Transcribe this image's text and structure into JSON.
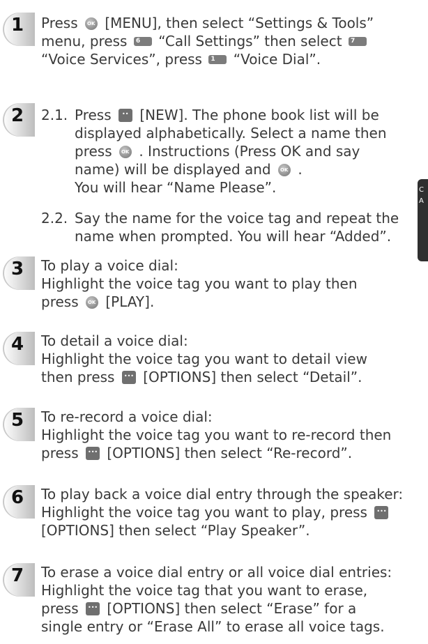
{
  "steps": [
    {
      "num": "1",
      "lines": [
        [
          "Press ",
          "ok",
          " [MENU], then select “Settings & Tools”"
        ],
        [
          "menu, press ",
          "6",
          " “Call Settings” then select ",
          "7",
          ""
        ],
        [
          "“Voice Services”, press ",
          "1",
          " “Voice Dial”."
        ]
      ]
    }
  ],
  "s1": {
    "l1a": "Press ",
    "l1b": " [MENU], then select “Settings & Tools”",
    "l2a": "menu, press ",
    "l2b": " “Call Settings” then select ",
    "l3a": "“Voice Services”, press ",
    "l3b": " “Voice Dial”."
  },
  "s2": {
    "num": "2",
    "n1": "2.1.",
    "l1a": "Press ",
    "l1b": " [NEW]. The phone book list will be",
    "l2": "displayed alphabetically. Select a name then",
    "l3a": "press ",
    "l3b": " . Instructions (Press OK and say",
    "l4a": "name) will be displayed and ",
    "l4b": " .",
    "l5": "You will hear “Name Please”.",
    "n2": "2.2.",
    "l6": "Say the name for the voice tag and repeat the",
    "l7": "name when prompted. You will hear “Added”."
  },
  "s3": {
    "num": "3",
    "l1": "To play a voice dial:",
    "l2": "Highlight the voice tag you want to play then",
    "l3a": "press ",
    "l3b": " [PLAY]."
  },
  "s4": {
    "num": "4",
    "l1": "To detail a voice dial:",
    "l2": "Highlight the voice tag you want to detail view",
    "l3a": "then press ",
    "l3b": " [OPTIONS] then select “Detail”."
  },
  "s5": {
    "num": "5",
    "l1": "To re-record a voice dial:",
    "l2": "Highlight the voice tag you want to re-record then",
    "l3a": "press ",
    "l3b": " [OPTIONS] then select “Re-record”."
  },
  "s6": {
    "num": "6",
    "l1": "To play back a voice dial entry through the speaker:",
    "l2a": "Highlight the voice tag you want to play, press ",
    "l3": "[OPTIONS] then select “Play Speaker”."
  },
  "s7": {
    "num": "7",
    "l1": "To erase a voice dial entry or all voice dial entries:",
    "l2": "Highlight the voice tag that you want to erase,",
    "l3a": "press ",
    "l3b": " [OPTIONS] then select “Erase” for a",
    "l4": "single entry or “Erase All” to erase all voice tags."
  },
  "side_tab": {
    "text": "C\nA"
  },
  "icons": [
    "ok-key-icon",
    "key-6-icon",
    "key-7-icon",
    "key-1-icon",
    "new-softkey-icon",
    "options-softkey-icon"
  ],
  "colors": {
    "text": "#3a3a3a",
    "badge": "#bdbdbd",
    "icon": "#7c7c7c"
  }
}
